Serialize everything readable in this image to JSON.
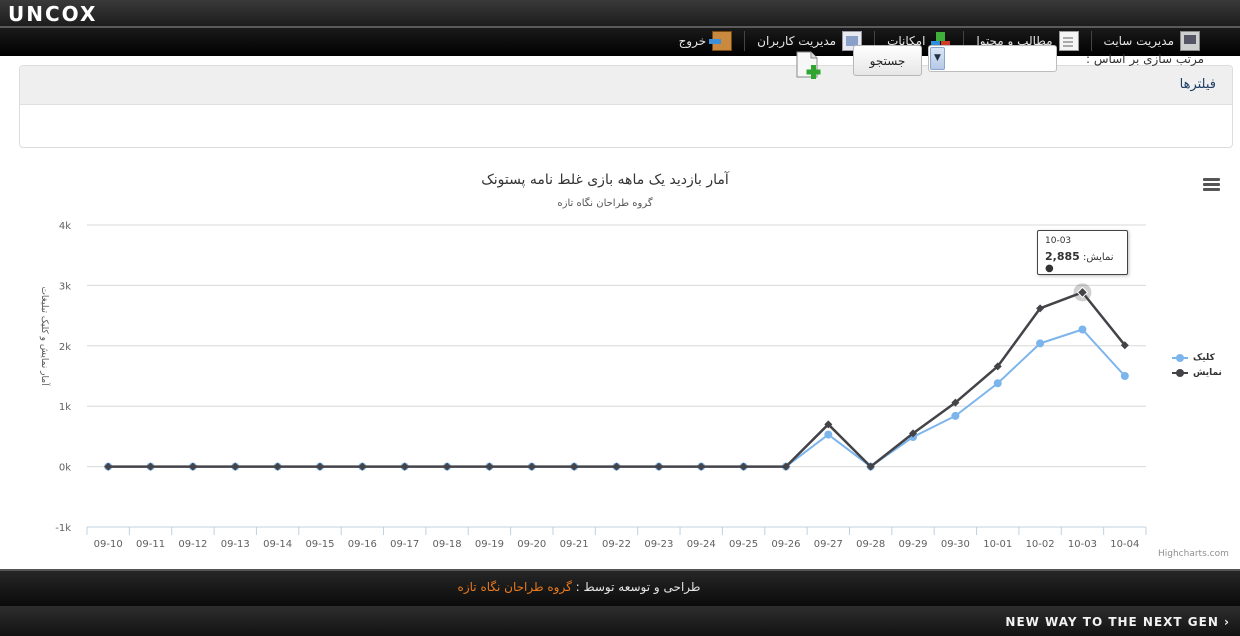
{
  "header": {
    "logo": "UNCOX",
    "nav": [
      {
        "label": "مدیریت سایت",
        "icon": "monitor-icon"
      },
      {
        "label": "مطالب و محتوا",
        "icon": "document-icon"
      },
      {
        "label": "امکانات",
        "icon": "blocks-icon"
      },
      {
        "label": "مدیریت کاربران",
        "icon": "users-icon"
      },
      {
        "label": "خروج",
        "icon": "exit-icon"
      }
    ]
  },
  "filters": {
    "title": "فیلترها",
    "sort_label": "مرتب سازی بر اساس :",
    "select_value": "",
    "search_label": "جستجو",
    "add_icon": "add-document-icon"
  },
  "chart_data": {
    "type": "line",
    "title": "آمار بازدید یک ماهه بازی غلط نامه پستونک",
    "subtitle": "گروه طراحان نگاه تازه",
    "ylabel": "آمار نمایش و کلیک تبلیغات",
    "xlabel": "",
    "categories": [
      "09-10",
      "09-11",
      "09-12",
      "09-13",
      "09-14",
      "09-15",
      "09-16",
      "09-17",
      "09-18",
      "09-19",
      "09-20",
      "09-21",
      "09-22",
      "09-23",
      "09-24",
      "09-25",
      "09-26",
      "09-27",
      "09-28",
      "09-29",
      "09-30",
      "10-01",
      "10-02",
      "10-03",
      "10-04"
    ],
    "ylim": [
      -1000,
      4000
    ],
    "yticks": [
      -1000,
      0,
      1000,
      2000,
      3000,
      4000
    ],
    "ytick_labels": [
      "-1k",
      "0k",
      "1k",
      "2k",
      "3k",
      "4k"
    ],
    "grid": true,
    "legend_position": "right",
    "series": [
      {
        "name": "کلیک",
        "color": "#7cb5ec",
        "values": [
          0,
          0,
          0,
          0,
          0,
          0,
          0,
          0,
          0,
          0,
          0,
          0,
          0,
          0,
          0,
          0,
          0,
          530,
          0,
          490,
          840,
          1380,
          2040,
          2270,
          1500
        ]
      },
      {
        "name": "نمایش",
        "color": "#434348",
        "values": [
          0,
          0,
          0,
          0,
          0,
          0,
          0,
          0,
          0,
          0,
          0,
          0,
          0,
          0,
          0,
          0,
          0,
          700,
          0,
          550,
          1060,
          1660,
          2620,
          2885,
          2010
        ]
      }
    ],
    "tooltip": {
      "category": "10-03",
      "series": "نمایش",
      "value_text": "2,885"
    },
    "credits": "Highcharts.com"
  },
  "footer": {
    "text": "طراحی و توسعه توسط :",
    "link": "گروه طراحان نگاه تازه",
    "slogan": "NEW WAY TO THE NEXT GEN ›"
  }
}
